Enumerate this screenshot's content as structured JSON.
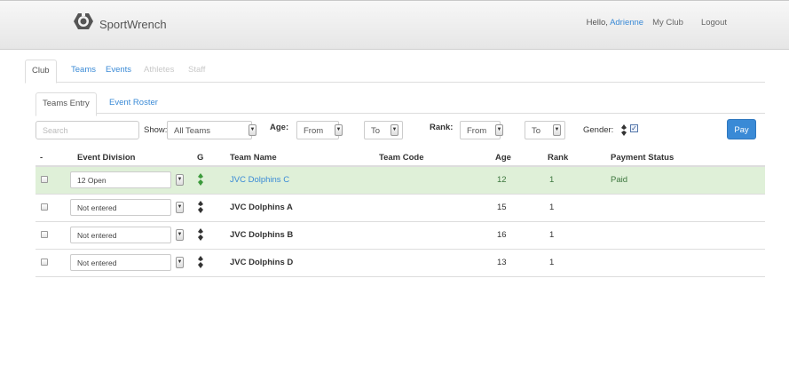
{
  "navbar": {
    "brand": "SportWrench",
    "hello_prefix": "Hello,",
    "user_name": "Adrienne",
    "my_club": "My Club",
    "logout": "Logout"
  },
  "main_tabs": [
    {
      "label": "Club",
      "state": "active"
    },
    {
      "label": "Teams",
      "state": "link"
    },
    {
      "label": "Events",
      "state": "link"
    },
    {
      "label": "Athletes",
      "state": "disabled"
    },
    {
      "label": "Staff",
      "state": "disabled"
    }
  ],
  "sub_tabs": [
    {
      "label": "Teams Entry",
      "state": "active"
    },
    {
      "label": "Event Roster",
      "state": "link"
    }
  ],
  "toolbar": {
    "search_placeholder": "Search",
    "show_label": "Show:",
    "show_value": "All Teams",
    "age_label": "Age:",
    "age_from": "From",
    "age_to": "To",
    "rank_label": "Rank:",
    "rank_from": "From",
    "rank_to": "To",
    "gender_label": "Gender:",
    "pay_button": "Pay"
  },
  "table": {
    "headers": {
      "select": "-",
      "event_division": "Event Division",
      "gender": "G",
      "team_name": "Team Name",
      "team_code": "Team Code",
      "age": "Age",
      "rank": "Rank",
      "payment_status": "Payment Status"
    },
    "rows": [
      {
        "division": "12 Open",
        "team_name": "JVC Dolphins C",
        "team_code": "",
        "age": "12",
        "rank": "1",
        "payment_status": "Paid",
        "highlight": true
      },
      {
        "division": "Not entered",
        "team_name": "JVC Dolphins A",
        "team_code": "",
        "age": "15",
        "rank": "1",
        "payment_status": "",
        "highlight": false
      },
      {
        "division": "Not entered",
        "team_name": "JVC Dolphins B",
        "team_code": "",
        "age": "16",
        "rank": "1",
        "payment_status": "",
        "highlight": false
      },
      {
        "division": "Not entered",
        "team_name": "JVC Dolphins D",
        "team_code": "",
        "age": "13",
        "rank": "1",
        "payment_status": "",
        "highlight": false
      }
    ]
  },
  "colors": {
    "accent": "#3a8ad6",
    "success_bg": "#dff0d8",
    "success_text": "#3c763d",
    "gender_icon_highlight": "#3c9a3c"
  },
  "icons": {
    "logo": "sportwrench-logo-icon",
    "gender": "gender-icon",
    "caret": "caret-down-icon",
    "checkbox": "checkbox-icon"
  }
}
